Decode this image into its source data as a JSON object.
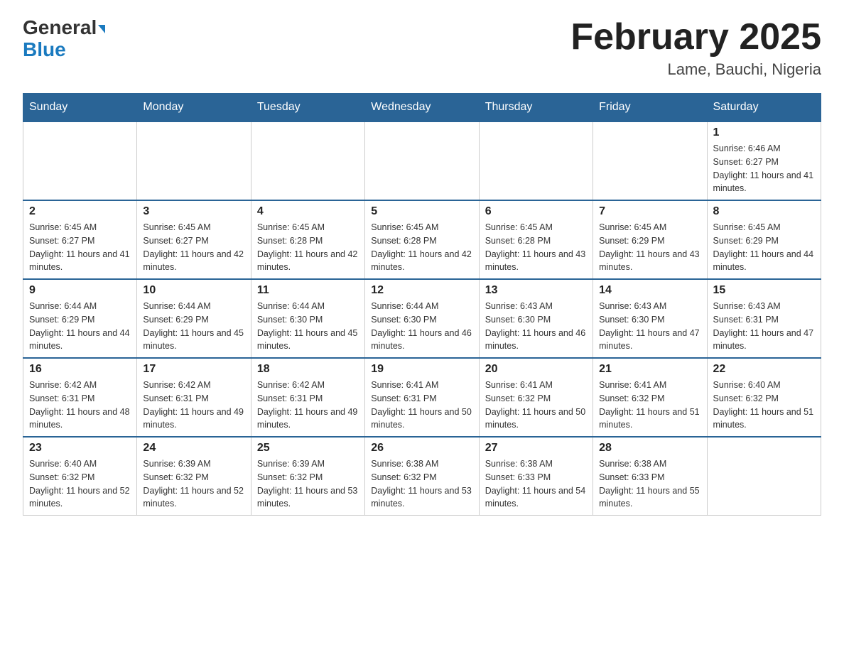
{
  "header": {
    "logo_general": "General",
    "logo_blue": "Blue",
    "month_year": "February 2025",
    "location": "Lame, Bauchi, Nigeria"
  },
  "weekdays": [
    "Sunday",
    "Monday",
    "Tuesday",
    "Wednesday",
    "Thursday",
    "Friday",
    "Saturday"
  ],
  "weeks": [
    [
      {
        "day": "",
        "sunrise": "",
        "sunset": "",
        "daylight": ""
      },
      {
        "day": "",
        "sunrise": "",
        "sunset": "",
        "daylight": ""
      },
      {
        "day": "",
        "sunrise": "",
        "sunset": "",
        "daylight": ""
      },
      {
        "day": "",
        "sunrise": "",
        "sunset": "",
        "daylight": ""
      },
      {
        "day": "",
        "sunrise": "",
        "sunset": "",
        "daylight": ""
      },
      {
        "day": "",
        "sunrise": "",
        "sunset": "",
        "daylight": ""
      },
      {
        "day": "1",
        "sunrise": "Sunrise: 6:46 AM",
        "sunset": "Sunset: 6:27 PM",
        "daylight": "Daylight: 11 hours and 41 minutes."
      }
    ],
    [
      {
        "day": "2",
        "sunrise": "Sunrise: 6:45 AM",
        "sunset": "Sunset: 6:27 PM",
        "daylight": "Daylight: 11 hours and 41 minutes."
      },
      {
        "day": "3",
        "sunrise": "Sunrise: 6:45 AM",
        "sunset": "Sunset: 6:27 PM",
        "daylight": "Daylight: 11 hours and 42 minutes."
      },
      {
        "day": "4",
        "sunrise": "Sunrise: 6:45 AM",
        "sunset": "Sunset: 6:28 PM",
        "daylight": "Daylight: 11 hours and 42 minutes."
      },
      {
        "day": "5",
        "sunrise": "Sunrise: 6:45 AM",
        "sunset": "Sunset: 6:28 PM",
        "daylight": "Daylight: 11 hours and 42 minutes."
      },
      {
        "day": "6",
        "sunrise": "Sunrise: 6:45 AM",
        "sunset": "Sunset: 6:28 PM",
        "daylight": "Daylight: 11 hours and 43 minutes."
      },
      {
        "day": "7",
        "sunrise": "Sunrise: 6:45 AM",
        "sunset": "Sunset: 6:29 PM",
        "daylight": "Daylight: 11 hours and 43 minutes."
      },
      {
        "day": "8",
        "sunrise": "Sunrise: 6:45 AM",
        "sunset": "Sunset: 6:29 PM",
        "daylight": "Daylight: 11 hours and 44 minutes."
      }
    ],
    [
      {
        "day": "9",
        "sunrise": "Sunrise: 6:44 AM",
        "sunset": "Sunset: 6:29 PM",
        "daylight": "Daylight: 11 hours and 44 minutes."
      },
      {
        "day": "10",
        "sunrise": "Sunrise: 6:44 AM",
        "sunset": "Sunset: 6:29 PM",
        "daylight": "Daylight: 11 hours and 45 minutes."
      },
      {
        "day": "11",
        "sunrise": "Sunrise: 6:44 AM",
        "sunset": "Sunset: 6:30 PM",
        "daylight": "Daylight: 11 hours and 45 minutes."
      },
      {
        "day": "12",
        "sunrise": "Sunrise: 6:44 AM",
        "sunset": "Sunset: 6:30 PM",
        "daylight": "Daylight: 11 hours and 46 minutes."
      },
      {
        "day": "13",
        "sunrise": "Sunrise: 6:43 AM",
        "sunset": "Sunset: 6:30 PM",
        "daylight": "Daylight: 11 hours and 46 minutes."
      },
      {
        "day": "14",
        "sunrise": "Sunrise: 6:43 AM",
        "sunset": "Sunset: 6:30 PM",
        "daylight": "Daylight: 11 hours and 47 minutes."
      },
      {
        "day": "15",
        "sunrise": "Sunrise: 6:43 AM",
        "sunset": "Sunset: 6:31 PM",
        "daylight": "Daylight: 11 hours and 47 minutes."
      }
    ],
    [
      {
        "day": "16",
        "sunrise": "Sunrise: 6:42 AM",
        "sunset": "Sunset: 6:31 PM",
        "daylight": "Daylight: 11 hours and 48 minutes."
      },
      {
        "day": "17",
        "sunrise": "Sunrise: 6:42 AM",
        "sunset": "Sunset: 6:31 PM",
        "daylight": "Daylight: 11 hours and 49 minutes."
      },
      {
        "day": "18",
        "sunrise": "Sunrise: 6:42 AM",
        "sunset": "Sunset: 6:31 PM",
        "daylight": "Daylight: 11 hours and 49 minutes."
      },
      {
        "day": "19",
        "sunrise": "Sunrise: 6:41 AM",
        "sunset": "Sunset: 6:31 PM",
        "daylight": "Daylight: 11 hours and 50 minutes."
      },
      {
        "day": "20",
        "sunrise": "Sunrise: 6:41 AM",
        "sunset": "Sunset: 6:32 PM",
        "daylight": "Daylight: 11 hours and 50 minutes."
      },
      {
        "day": "21",
        "sunrise": "Sunrise: 6:41 AM",
        "sunset": "Sunset: 6:32 PM",
        "daylight": "Daylight: 11 hours and 51 minutes."
      },
      {
        "day": "22",
        "sunrise": "Sunrise: 6:40 AM",
        "sunset": "Sunset: 6:32 PM",
        "daylight": "Daylight: 11 hours and 51 minutes."
      }
    ],
    [
      {
        "day": "23",
        "sunrise": "Sunrise: 6:40 AM",
        "sunset": "Sunset: 6:32 PM",
        "daylight": "Daylight: 11 hours and 52 minutes."
      },
      {
        "day": "24",
        "sunrise": "Sunrise: 6:39 AM",
        "sunset": "Sunset: 6:32 PM",
        "daylight": "Daylight: 11 hours and 52 minutes."
      },
      {
        "day": "25",
        "sunrise": "Sunrise: 6:39 AM",
        "sunset": "Sunset: 6:32 PM",
        "daylight": "Daylight: 11 hours and 53 minutes."
      },
      {
        "day": "26",
        "sunrise": "Sunrise: 6:38 AM",
        "sunset": "Sunset: 6:32 PM",
        "daylight": "Daylight: 11 hours and 53 minutes."
      },
      {
        "day": "27",
        "sunrise": "Sunrise: 6:38 AM",
        "sunset": "Sunset: 6:33 PM",
        "daylight": "Daylight: 11 hours and 54 minutes."
      },
      {
        "day": "28",
        "sunrise": "Sunrise: 6:38 AM",
        "sunset": "Sunset: 6:33 PM",
        "daylight": "Daylight: 11 hours and 55 minutes."
      },
      {
        "day": "",
        "sunrise": "",
        "sunset": "",
        "daylight": ""
      }
    ]
  ]
}
